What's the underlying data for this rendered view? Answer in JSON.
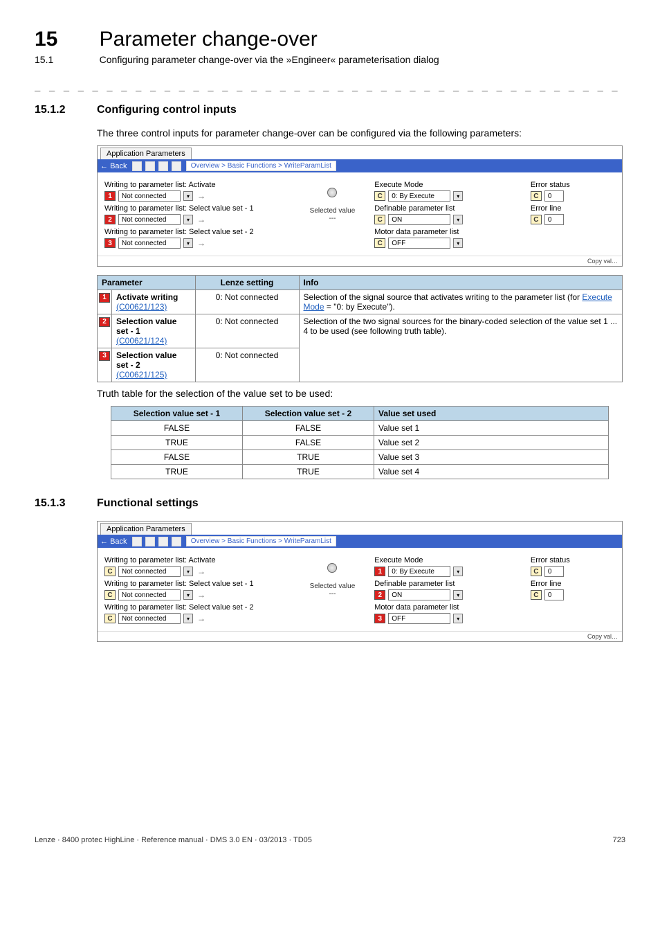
{
  "header": {
    "chapter_num": "15",
    "chapter_title": "Parameter change-over",
    "sub_num": "15.1",
    "sub_title": "Configuring parameter change-over via the »Engineer« parameterisation dialog"
  },
  "sep": "_ _ _ _ _ _ _ _ _ _ _ _ _ _ _ _ _ _ _ _ _ _ _ _ _ _ _ _ _ _ _ _ _ _ _ _ _ _ _ _ _ _ _ _ _ _ _ _ _ _ _ _ _ _ _ _ _ _ _ _ _ _",
  "s1512": {
    "num": "15.1.2",
    "title": "Configuring control inputs",
    "intro": "The three control inputs for parameter change-over can be configured via the following parameters:"
  },
  "ss": {
    "tab": "Application Parameters",
    "back": "Back",
    "breadcrumb": "Overview > Basic Functions > WriteParamList",
    "l_activate": "Writing to parameter list: Activate",
    "l_sel1": "Writing to parameter list: Select value set - 1",
    "l_sel2": "Writing to parameter list: Select value set - 2",
    "v_notconn": "Not connected",
    "mid_selected": "Selected value",
    "mid_dash": "---",
    "r_exec": "Execute Mode",
    "r_exec_v": "0: By Execute",
    "r_def": "Definable parameter list",
    "r_def_v": "ON",
    "r_motor": "Motor data parameter list",
    "r_motor_v": "OFF",
    "f_errstat": "Error status",
    "f_errline": "Error line",
    "f_zero": "0",
    "copy": "Copy val…",
    "c": "C"
  },
  "ptable": {
    "h_param": "Parameter",
    "h_lenze": "Lenze setting",
    "h_info": "Info",
    "rows": [
      {
        "n": "1",
        "name": "Activate writing",
        "code": "(C00621/123)",
        "lenze": "0: Not connected",
        "info_a": "Selection of the signal source that activates writing to the parameter list (for ",
        "info_link": "Execute Mode",
        "info_b": " = \"0: by Execute\")."
      },
      {
        "n": "2",
        "name": "Selection value set - 1",
        "code": "(C00621/124)",
        "lenze": "0: Not connected",
        "info_a": "Selection of the two signal sources for the binary-coded selection of the value set 1 ... 4 to be used (see following truth table).",
        "info_link": "",
        "info_b": ""
      },
      {
        "n": "3",
        "name": "Selection value set - 2",
        "code": "(C00621/125)",
        "lenze": "0: Not connected",
        "info_a": "",
        "info_link": "",
        "info_b": ""
      }
    ]
  },
  "truth_intro": "Truth table for the selection of the value set to be used:",
  "truth": {
    "h1": "Selection value set - 1",
    "h2": "Selection value set - 2",
    "h3": "Value set used",
    "rows": [
      {
        "a": "FALSE",
        "b": "FALSE",
        "v": "Value set 1"
      },
      {
        "a": "TRUE",
        "b": "FALSE",
        "v": "Value set 2"
      },
      {
        "a": "FALSE",
        "b": "TRUE",
        "v": "Value set 3"
      },
      {
        "a": "TRUE",
        "b": "TRUE",
        "v": "Value set 4"
      }
    ]
  },
  "s1513": {
    "num": "15.1.3",
    "title": "Functional settings"
  },
  "footer": {
    "left": "Lenze · 8400 protec HighLine · Reference manual · DMS 3.0 EN · 03/2013 · TD05",
    "right": "723"
  }
}
